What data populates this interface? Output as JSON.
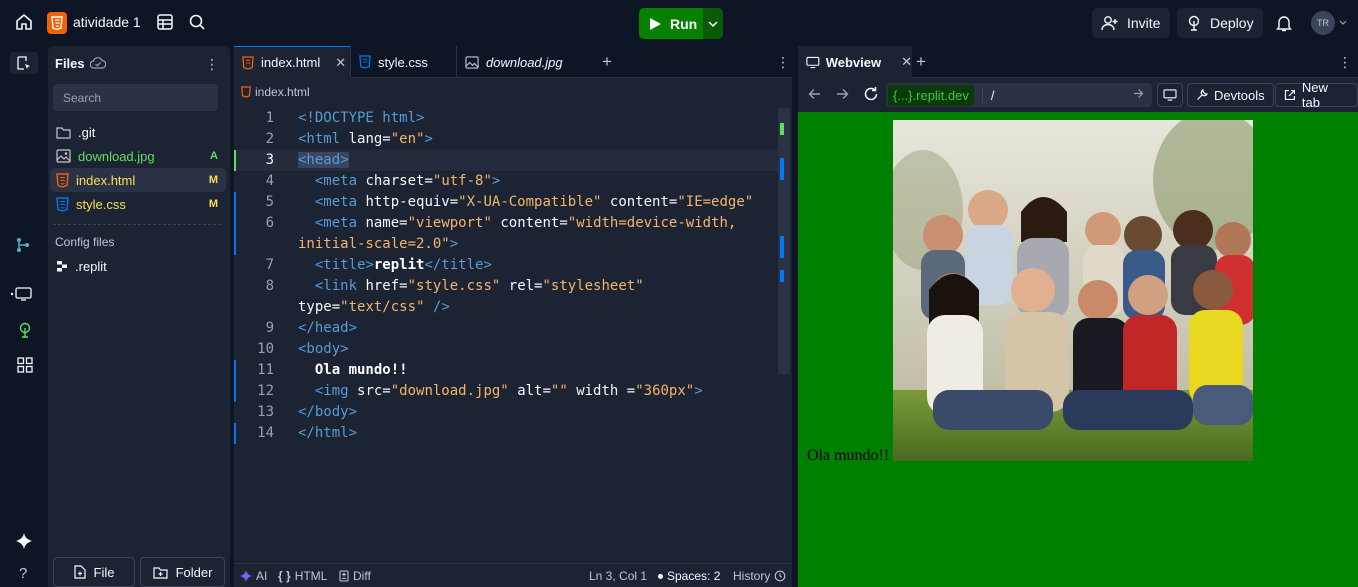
{
  "header": {
    "project_name": "atividade 1",
    "run_label": "Run",
    "invite_label": "Invite",
    "deploy_label": "Deploy",
    "avatar_initials": "TR"
  },
  "files": {
    "title": "Files",
    "search_placeholder": "Search",
    "items": [
      {
        "name": ".git",
        "badge": "",
        "color": "#f5f9fc",
        "icon": "folder-icon"
      },
      {
        "name": "download.jpg",
        "badge": "A",
        "color": "#5ee05e",
        "icon": "image-icon"
      },
      {
        "name": "index.html",
        "badge": "M",
        "color": "#f5e050",
        "icon": "html5-icon"
      },
      {
        "name": "style.css",
        "badge": "M",
        "color": "#f5e050",
        "icon": "css3-icon"
      }
    ],
    "config_title": "Config files",
    "config_items": [
      {
        "name": ".replit",
        "icon": "replit-icon"
      }
    ],
    "new_file_label": "File",
    "new_folder_label": "Folder"
  },
  "editor": {
    "tabs": [
      {
        "label": "index.html",
        "icon": "html5-icon",
        "active": true
      },
      {
        "label": "style.css",
        "icon": "css3-icon",
        "active": false
      },
      {
        "label": "download.jpg",
        "icon": "image-icon",
        "active": false
      }
    ],
    "breadcrumb": "index.html",
    "line_numbers": [
      "1",
      "2",
      "3",
      "4",
      "5",
      "6",
      "",
      "7",
      "8",
      "",
      "9",
      "10",
      "11",
      "12",
      "13",
      "14"
    ],
    "status": {
      "ai": "AI",
      "lang": "HTML",
      "diff": "Diff",
      "position": "Ln 3, Col 1",
      "spaces": "Spaces: 2",
      "history": "History"
    }
  },
  "webview": {
    "tab_label": "Webview",
    "domain": "{...}.replit.dev",
    "path": "/",
    "devtools_label": "Devtools",
    "new_tab_label": "New tab",
    "preview_text": "Ola mundo!!",
    "preview_bg": "#008000"
  },
  "colors": {
    "accent": "#0079f2",
    "run": "#058000",
    "html": "#f26207",
    "css": "#0079f2"
  }
}
